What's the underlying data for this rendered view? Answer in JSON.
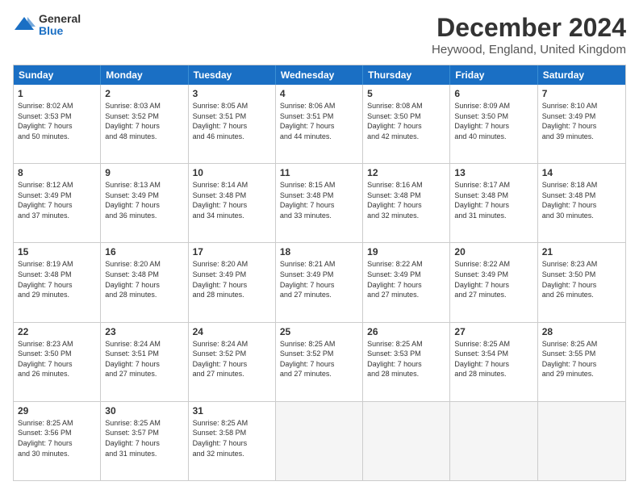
{
  "logo": {
    "general": "General",
    "blue": "Blue"
  },
  "title": "December 2024",
  "subtitle": "Heywood, England, United Kingdom",
  "headers": [
    "Sunday",
    "Monday",
    "Tuesday",
    "Wednesday",
    "Thursday",
    "Friday",
    "Saturday"
  ],
  "weeks": [
    [
      {
        "day": "1",
        "lines": [
          "Sunrise: 8:02 AM",
          "Sunset: 3:53 PM",
          "Daylight: 7 hours",
          "and 50 minutes."
        ]
      },
      {
        "day": "2",
        "lines": [
          "Sunrise: 8:03 AM",
          "Sunset: 3:52 PM",
          "Daylight: 7 hours",
          "and 48 minutes."
        ]
      },
      {
        "day": "3",
        "lines": [
          "Sunrise: 8:05 AM",
          "Sunset: 3:51 PM",
          "Daylight: 7 hours",
          "and 46 minutes."
        ]
      },
      {
        "day": "4",
        "lines": [
          "Sunrise: 8:06 AM",
          "Sunset: 3:51 PM",
          "Daylight: 7 hours",
          "and 44 minutes."
        ]
      },
      {
        "day": "5",
        "lines": [
          "Sunrise: 8:08 AM",
          "Sunset: 3:50 PM",
          "Daylight: 7 hours",
          "and 42 minutes."
        ]
      },
      {
        "day": "6",
        "lines": [
          "Sunrise: 8:09 AM",
          "Sunset: 3:50 PM",
          "Daylight: 7 hours",
          "and 40 minutes."
        ]
      },
      {
        "day": "7",
        "lines": [
          "Sunrise: 8:10 AM",
          "Sunset: 3:49 PM",
          "Daylight: 7 hours",
          "and 39 minutes."
        ]
      }
    ],
    [
      {
        "day": "8",
        "lines": [
          "Sunrise: 8:12 AM",
          "Sunset: 3:49 PM",
          "Daylight: 7 hours",
          "and 37 minutes."
        ]
      },
      {
        "day": "9",
        "lines": [
          "Sunrise: 8:13 AM",
          "Sunset: 3:49 PM",
          "Daylight: 7 hours",
          "and 36 minutes."
        ]
      },
      {
        "day": "10",
        "lines": [
          "Sunrise: 8:14 AM",
          "Sunset: 3:48 PM",
          "Daylight: 7 hours",
          "and 34 minutes."
        ]
      },
      {
        "day": "11",
        "lines": [
          "Sunrise: 8:15 AM",
          "Sunset: 3:48 PM",
          "Daylight: 7 hours",
          "and 33 minutes."
        ]
      },
      {
        "day": "12",
        "lines": [
          "Sunrise: 8:16 AM",
          "Sunset: 3:48 PM",
          "Daylight: 7 hours",
          "and 32 minutes."
        ]
      },
      {
        "day": "13",
        "lines": [
          "Sunrise: 8:17 AM",
          "Sunset: 3:48 PM",
          "Daylight: 7 hours",
          "and 31 minutes."
        ]
      },
      {
        "day": "14",
        "lines": [
          "Sunrise: 8:18 AM",
          "Sunset: 3:48 PM",
          "Daylight: 7 hours",
          "and 30 minutes."
        ]
      }
    ],
    [
      {
        "day": "15",
        "lines": [
          "Sunrise: 8:19 AM",
          "Sunset: 3:48 PM",
          "Daylight: 7 hours",
          "and 29 minutes."
        ]
      },
      {
        "day": "16",
        "lines": [
          "Sunrise: 8:20 AM",
          "Sunset: 3:48 PM",
          "Daylight: 7 hours",
          "and 28 minutes."
        ]
      },
      {
        "day": "17",
        "lines": [
          "Sunrise: 8:20 AM",
          "Sunset: 3:49 PM",
          "Daylight: 7 hours",
          "and 28 minutes."
        ]
      },
      {
        "day": "18",
        "lines": [
          "Sunrise: 8:21 AM",
          "Sunset: 3:49 PM",
          "Daylight: 7 hours",
          "and 27 minutes."
        ]
      },
      {
        "day": "19",
        "lines": [
          "Sunrise: 8:22 AM",
          "Sunset: 3:49 PM",
          "Daylight: 7 hours",
          "and 27 minutes."
        ]
      },
      {
        "day": "20",
        "lines": [
          "Sunrise: 8:22 AM",
          "Sunset: 3:49 PM",
          "Daylight: 7 hours",
          "and 27 minutes."
        ]
      },
      {
        "day": "21",
        "lines": [
          "Sunrise: 8:23 AM",
          "Sunset: 3:50 PM",
          "Daylight: 7 hours",
          "and 26 minutes."
        ]
      }
    ],
    [
      {
        "day": "22",
        "lines": [
          "Sunrise: 8:23 AM",
          "Sunset: 3:50 PM",
          "Daylight: 7 hours",
          "and 26 minutes."
        ]
      },
      {
        "day": "23",
        "lines": [
          "Sunrise: 8:24 AM",
          "Sunset: 3:51 PM",
          "Daylight: 7 hours",
          "and 27 minutes."
        ]
      },
      {
        "day": "24",
        "lines": [
          "Sunrise: 8:24 AM",
          "Sunset: 3:52 PM",
          "Daylight: 7 hours",
          "and 27 minutes."
        ]
      },
      {
        "day": "25",
        "lines": [
          "Sunrise: 8:25 AM",
          "Sunset: 3:52 PM",
          "Daylight: 7 hours",
          "and 27 minutes."
        ]
      },
      {
        "day": "26",
        "lines": [
          "Sunrise: 8:25 AM",
          "Sunset: 3:53 PM",
          "Daylight: 7 hours",
          "and 28 minutes."
        ]
      },
      {
        "day": "27",
        "lines": [
          "Sunrise: 8:25 AM",
          "Sunset: 3:54 PM",
          "Daylight: 7 hours",
          "and 28 minutes."
        ]
      },
      {
        "day": "28",
        "lines": [
          "Sunrise: 8:25 AM",
          "Sunset: 3:55 PM",
          "Daylight: 7 hours",
          "and 29 minutes."
        ]
      }
    ],
    [
      {
        "day": "29",
        "lines": [
          "Sunrise: 8:25 AM",
          "Sunset: 3:56 PM",
          "Daylight: 7 hours",
          "and 30 minutes."
        ]
      },
      {
        "day": "30",
        "lines": [
          "Sunrise: 8:25 AM",
          "Sunset: 3:57 PM",
          "Daylight: 7 hours",
          "and 31 minutes."
        ]
      },
      {
        "day": "31",
        "lines": [
          "Sunrise: 8:25 AM",
          "Sunset: 3:58 PM",
          "Daylight: 7 hours",
          "and 32 minutes."
        ]
      },
      null,
      null,
      null,
      null
    ]
  ]
}
